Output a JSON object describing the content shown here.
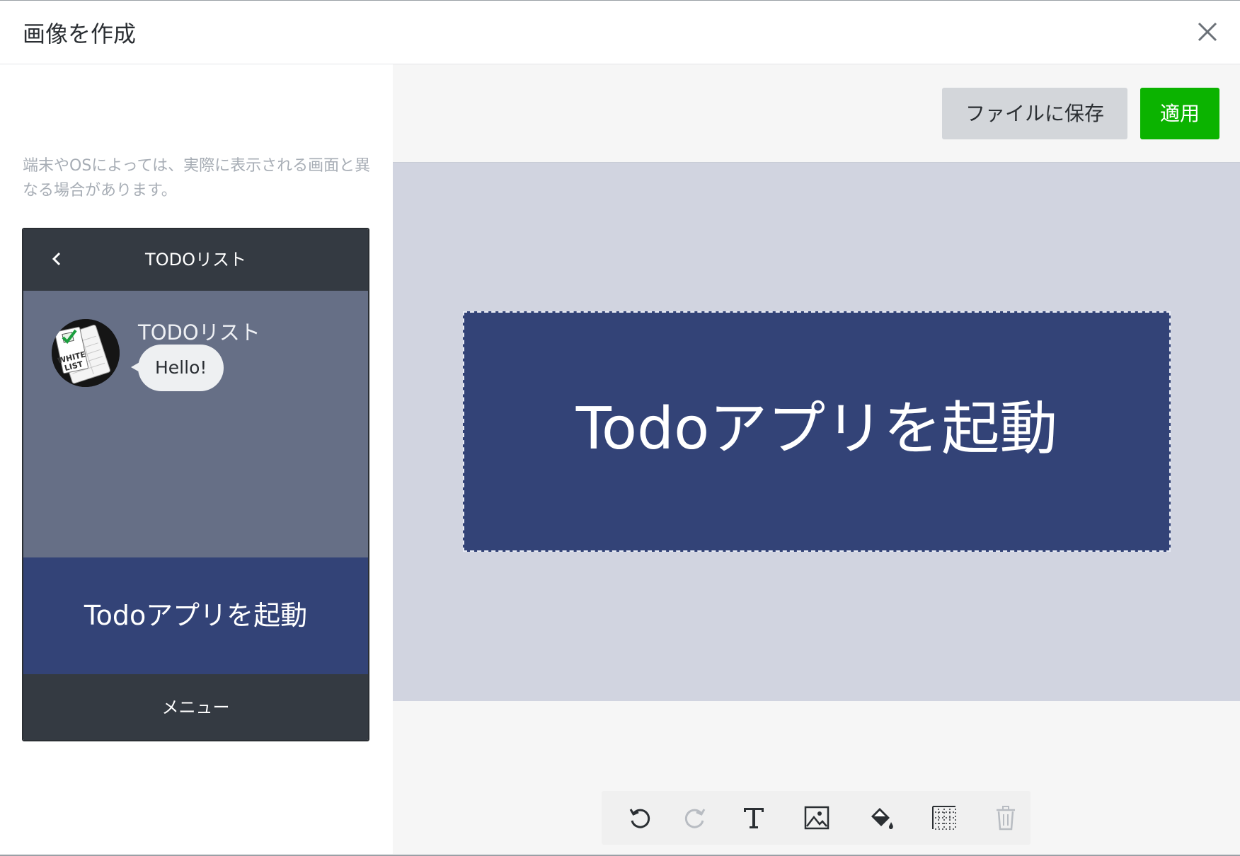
{
  "dialog": {
    "title": "画像を作成",
    "close_icon": "close-icon"
  },
  "left": {
    "notice": "端末やOSによっては、実際に表示される画面と異なる場合があります。",
    "phone": {
      "header_title": "TODOリスト",
      "back_icon": "chevron-left-icon",
      "chat": {
        "name": "TODOリスト",
        "message": "Hello!",
        "avatar_icon": "white-list-avatar",
        "avatar_text": "WHITE LIST"
      },
      "rich_menu_label": "Todoアプリを起動",
      "menu_bar_label": "メニュー"
    }
  },
  "right": {
    "save_button": "ファイルに保存",
    "apply_button": "適用",
    "canvas_text": "Todoアプリを起動",
    "canvas_bg_color": "#334377",
    "apply_color": "#0bb300",
    "toolbar": [
      {
        "icon": "undo-icon",
        "enabled": true
      },
      {
        "icon": "redo-icon",
        "enabled": false
      },
      {
        "icon": "text-icon",
        "enabled": true
      },
      {
        "icon": "image-icon",
        "enabled": true
      },
      {
        "icon": "paint-bucket-icon",
        "enabled": true
      },
      {
        "icon": "grid-icon",
        "enabled": true
      },
      {
        "icon": "trash-icon",
        "enabled": false
      }
    ]
  }
}
